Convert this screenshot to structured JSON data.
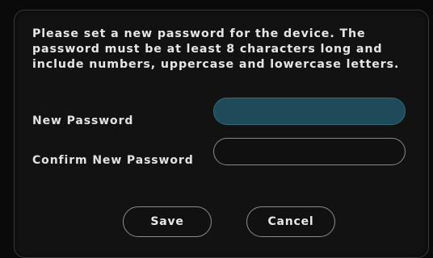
{
  "dialog": {
    "message": "Please set a new password for the device. The password must be at least 8 characters long and include numbers, uppercase and lowercase letters.",
    "new_password_label": "New Password",
    "confirm_password_label": "Confirm New Password",
    "new_password_value": "",
    "confirm_password_value": "",
    "save_label": "Save",
    "cancel_label": "Cancel"
  },
  "colors": {
    "background": "#0a0a0a",
    "dialog_background": "#121212",
    "focused_input": "#1f4a5a",
    "text": "#e6e6e6",
    "border": "#8a8a8a"
  }
}
